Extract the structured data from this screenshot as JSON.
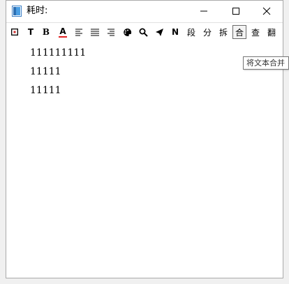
{
  "window": {
    "title": "耗时:",
    "minimize_icon": "minimize-icon",
    "maximize_icon": "maximize-icon",
    "close_icon": "close-icon"
  },
  "toolbar": {
    "items": [
      {
        "icon": "frame-icon"
      },
      {
        "label": "T"
      },
      {
        "label": "B"
      },
      {
        "label": "A"
      },
      {
        "icon": "align-left-icon"
      },
      {
        "icon": "align-justify-icon"
      },
      {
        "icon": "align-right-icon"
      },
      {
        "icon": "palette-icon"
      },
      {
        "icon": "search-icon"
      },
      {
        "icon": "send-icon"
      },
      {
        "label": "N"
      },
      {
        "label": "段"
      },
      {
        "label": "分"
      },
      {
        "label": "拆"
      },
      {
        "label": "合"
      },
      {
        "label": "查"
      },
      {
        "label": "翻"
      }
    ],
    "active_label": "合"
  },
  "content": {
    "lines": [
      "111111111",
      "11111",
      "11111"
    ]
  },
  "tooltip": {
    "text": "将文本合并"
  }
}
